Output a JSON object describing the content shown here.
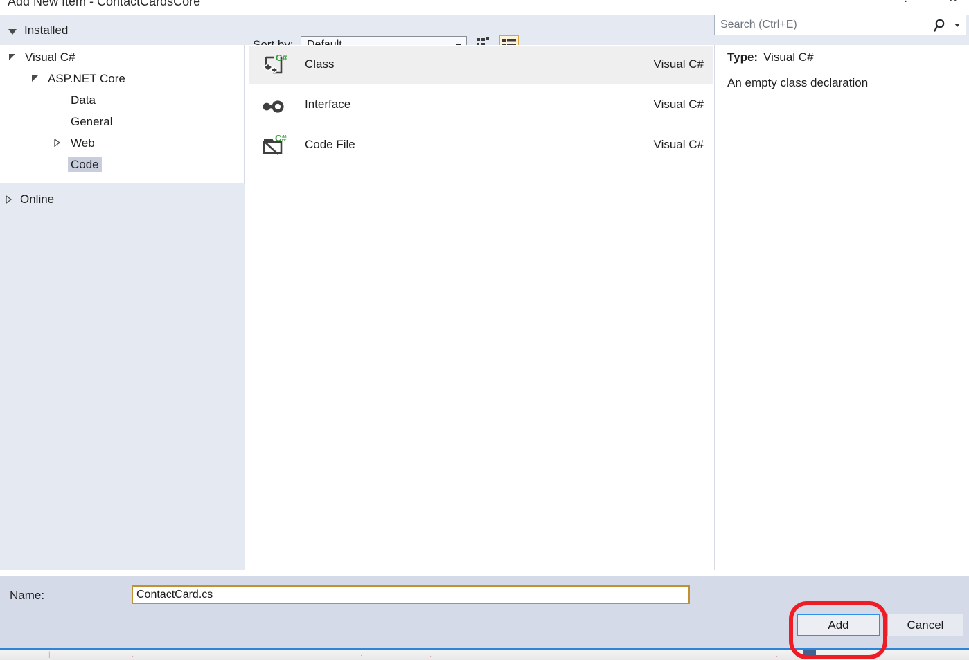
{
  "window": {
    "title": "Add New Item - ContactCardsCore",
    "help_button": "?",
    "close_button": "✕"
  },
  "toolbar": {
    "installed_label": "Installed",
    "sort_by_label": "Sort by:",
    "sort_by_value": "Default",
    "view_medium_icons": "medium-icons-view",
    "view_list_details": "list-details-view",
    "view_selected": "list-details-view"
  },
  "search": {
    "placeholder": "Search (Ctrl+E)",
    "icon": "search-icon",
    "dropdown_icon": "chevron-down-icon"
  },
  "tree": {
    "items": [
      {
        "label": "Visual C#",
        "depth": 0,
        "expander": "expanded",
        "selected": false
      },
      {
        "label": "ASP.NET Core",
        "depth": 1,
        "expander": "expanded",
        "selected": false
      },
      {
        "label": "Data",
        "depth": 2,
        "expander": "none",
        "selected": false
      },
      {
        "label": "General",
        "depth": 2,
        "expander": "none",
        "selected": false
      },
      {
        "label": "Web",
        "depth": 2,
        "expander": "collapsed",
        "selected": false
      },
      {
        "label": "Code",
        "depth": 2,
        "expander": "none",
        "selected": true
      }
    ],
    "online_label": "Online",
    "online_expander": "collapsed"
  },
  "templates": {
    "language_column": "Visual C#",
    "items": [
      {
        "name": "Class",
        "language": "Visual C#",
        "icon": "class-icon",
        "selected": true
      },
      {
        "name": "Interface",
        "language": "Visual C#",
        "icon": "interface-icon",
        "selected": false
      },
      {
        "name": "Code File",
        "language": "Visual C#",
        "icon": "code-file-icon",
        "selected": false
      }
    ]
  },
  "details": {
    "type_key": "Type:",
    "type_value": "Visual C#",
    "description": "An empty class declaration"
  },
  "footer": {
    "name_label_pre": "",
    "name_label_accel": "N",
    "name_label_post": "ame:",
    "name_value": "ContactCard.cs",
    "add_accel": "A",
    "add_rest": "dd",
    "cancel_label": "Cancel"
  },
  "annotation": {
    "shape": "red-rounded-rectangle",
    "color": "#ee1c25",
    "targets": "add-button"
  },
  "colors": {
    "chrome": "#e4e9f2",
    "footer": "#d4dae8",
    "selected_row": "#efefef",
    "tree_selection": "#c9cede",
    "focus_border": "#2e90e8",
    "name_field_border": "#c09033",
    "view_toggle_border": "#d8a644",
    "dialog_bottom_rule": "#2e84d8",
    "csharp_green": "#3b9a3b"
  }
}
